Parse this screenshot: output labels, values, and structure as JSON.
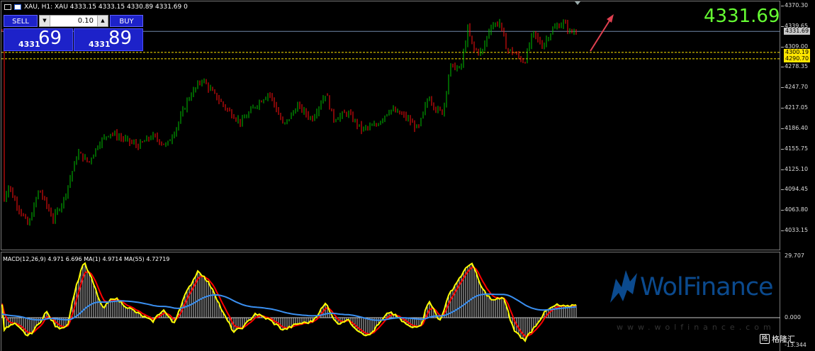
{
  "header": {
    "symbol_line": "XAU, H1:  XAU  4333.15 4333.15 4330.89 4331.69  0"
  },
  "trade_panel": {
    "sell_label": "SELL",
    "buy_label": "BUY",
    "lot": "0.10",
    "sell_small": "4331",
    "sell_big": "69",
    "buy_small": "4331",
    "buy_big": "89"
  },
  "big_price": "4331.69",
  "price_scale": {
    "ticks": [
      "4370.30",
      "4339.65",
      "4309.00",
      "4278.35",
      "4247.70",
      "4217.05",
      "4186.40",
      "4155.75",
      "4125.10",
      "4094.45",
      "4063.80",
      "4033.15"
    ],
    "current_tag": "4331.69",
    "level_tags": [
      "4300.19",
      "4290.70"
    ]
  },
  "macd": {
    "label": "MACD(12,26,9) 4.971 6.696 MA(1) 4.9714 MA(55) 4.72719",
    "scale_ticks": [
      "29.707",
      "0.000",
      "-13.344"
    ]
  },
  "watermark": {
    "brand": "WolFinance",
    "url": "www.wolfinance.com",
    "gelonghui": "格隆汇"
  },
  "colors": {
    "bull_candle": "#00c000",
    "bear_candle": "#ff1010",
    "macd_hist": "#c8c8c8",
    "macd_line": "#ffff00",
    "signal_line": "#ff0000",
    "ma55_line": "#3a8ff0",
    "level_line": "#ffe600",
    "arrow": "#e04050"
  },
  "icons": [
    "chart-window-icon",
    "symbol-flag-icon",
    "caret-down-icon",
    "caret-up-icon",
    "arrow-up-right-icon",
    "wolf-logo-icon"
  ]
}
